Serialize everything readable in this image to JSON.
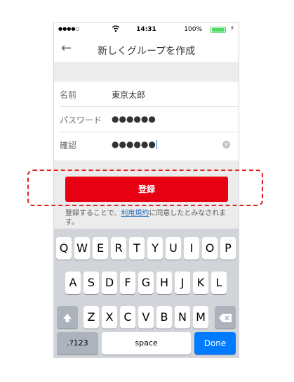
{
  "status_bar": {
    "signal": "●●●●○",
    "time": "14:31",
    "battery": "100%",
    "battery_level": 1.0
  },
  "nav": {
    "back_icon": "arrow-left-icon",
    "title": "新しくグループを作成"
  },
  "form": {
    "name_label": "名前",
    "name_value": "東京太郎",
    "password_label": "パスワード",
    "password_value": "●●●●●●",
    "confirm_label": "確認",
    "confirm_value": "●●●●●●"
  },
  "register_button": "登録",
  "agreement": {
    "before": "登録することで、",
    "link": "利用規約",
    "after": "に同意したとみなされます。"
  },
  "keyboard": {
    "row1": [
      "Q",
      "W",
      "E",
      "R",
      "T",
      "Y",
      "U",
      "I",
      "O",
      "P"
    ],
    "row2": [
      "A",
      "S",
      "D",
      "F",
      "G",
      "H",
      "J",
      "K",
      "L"
    ],
    "row3": [
      "Z",
      "X",
      "C",
      "V",
      "B",
      "N",
      "M"
    ],
    "shift_icon": "shift-icon",
    "delete_icon": "delete-icon",
    "numbers": ".?123",
    "space": "space",
    "done": "Done"
  },
  "colors": {
    "accent_red": "#e60012",
    "link_blue": "#2a6ebb",
    "done_blue": "#007aff",
    "highlight": "#e02020"
  }
}
